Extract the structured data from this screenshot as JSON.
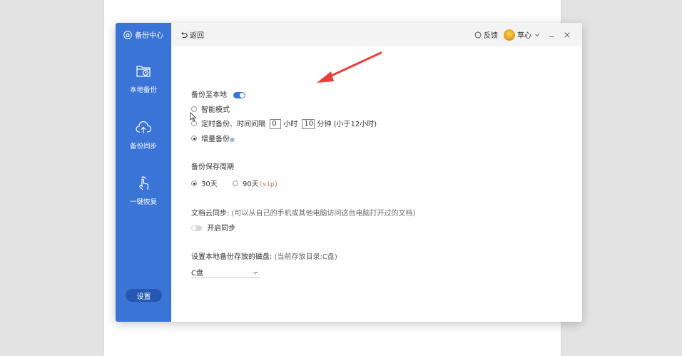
{
  "sidebar": {
    "header_title": "备份中心",
    "items": [
      {
        "label": "本地备份"
      },
      {
        "label": "备份同步"
      },
      {
        "label": "一键恢复"
      }
    ],
    "settings_label": "设置"
  },
  "topbar": {
    "back_label": "返回",
    "feedback_label": "反馈",
    "user_name": "草心"
  },
  "backup_local": {
    "title": "备份至本地",
    "enabled": true,
    "options": {
      "smart": "智能模式",
      "timed_prefix": "定时备份、时间间隔",
      "hours_value": "0",
      "hours_unit": "小时",
      "minutes_value": "10",
      "minutes_unit": "分钟",
      "timed_note": "(小于12小时)",
      "incremental": "增量备份"
    },
    "selected": "incremental"
  },
  "retention": {
    "title": "备份保存周期",
    "opt_30": "30天",
    "opt_90": "90天",
    "vip_tag": "(vip)",
    "selected": "30"
  },
  "cloud": {
    "title": "文档云同步:",
    "note": "(可以从自己的手机或其他电脑访问这台电脑打开过的文档)",
    "toggle_label": "开启同步",
    "enabled": false
  },
  "disk": {
    "title": "设置本地备份存放的磁盘:",
    "note": "(当前存放目录:C盘)",
    "selected_value": "C盘"
  },
  "colors": {
    "sidebar": "#3a74d6",
    "accent": "#3a74d6",
    "annotation_arrow": "#e8413d"
  }
}
